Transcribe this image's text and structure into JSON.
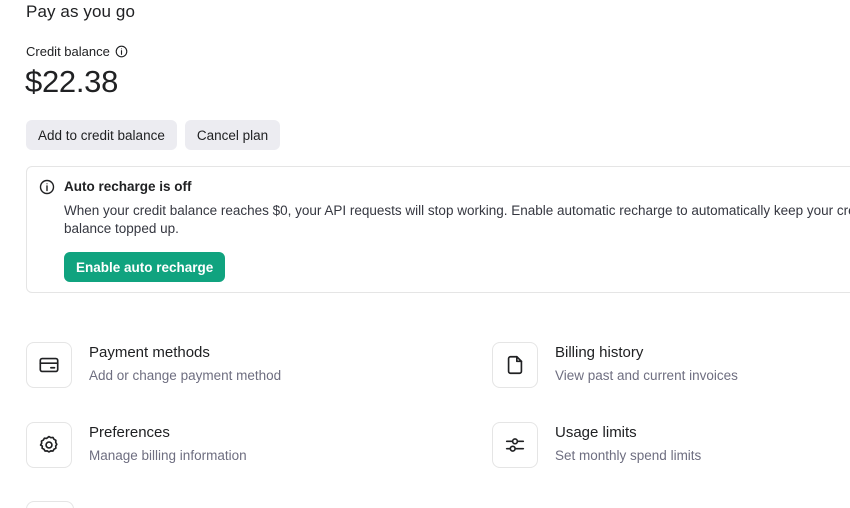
{
  "page": {
    "title": "Pay as you go"
  },
  "credit": {
    "label": "Credit balance",
    "amount": "$22.38"
  },
  "actions": {
    "add_credit": "Add to credit balance",
    "cancel_plan": "Cancel plan"
  },
  "auto_recharge": {
    "title": "Auto recharge is off",
    "body": "When your credit balance reaches $0, your API requests will stop working. Enable automatic recharge to automatically keep your credit balance topped up.",
    "button": "Enable auto recharge"
  },
  "cards": [
    {
      "title": "Payment methods",
      "subtitle": "Add or change payment method",
      "icon": "credit-card-icon"
    },
    {
      "title": "Billing history",
      "subtitle": "View past and current invoices",
      "icon": "document-icon"
    },
    {
      "title": "Preferences",
      "subtitle": "Manage billing information",
      "icon": "gear-icon"
    },
    {
      "title": "Usage limits",
      "subtitle": "Set monthly spend limits",
      "icon": "sliders-icon"
    }
  ],
  "colors": {
    "primary": "#10a37f",
    "secondary_bg": "#ececf1",
    "text": "#202123",
    "muted": "#6e6e80",
    "border": "#e5e5e5"
  }
}
